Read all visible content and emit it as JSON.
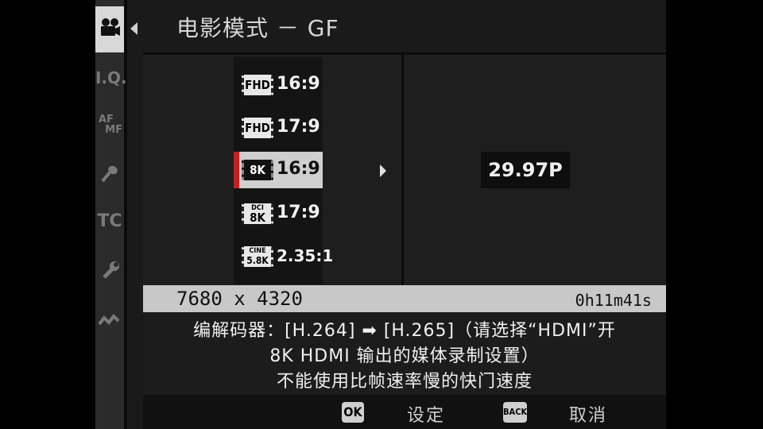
{
  "header": {
    "title": "电影模式 － GF"
  },
  "rail": {
    "icons": [
      {
        "name": "movie-camera-icon",
        "glyph": "🎥"
      },
      {
        "name": "image-quality-icon",
        "glyph": "I.Q."
      },
      {
        "name": "af-mf-icon",
        "glyph": "AF\nMF"
      },
      {
        "name": "microphone-icon",
        "glyph": "🎤"
      },
      {
        "name": "timecode-icon",
        "glyph": "TC"
      },
      {
        "name": "wrench-icon",
        "glyph": "🔧"
      },
      {
        "name": "connection-icon",
        "glyph": "⟿"
      }
    ]
  },
  "list": {
    "items": [
      {
        "badge_top": "",
        "badge": "FHD",
        "ratio": "16:9",
        "selected": false
      },
      {
        "badge_top": "",
        "badge": "FHD",
        "ratio": "17:9",
        "selected": false
      },
      {
        "badge_top": "",
        "badge": "8K",
        "ratio": "16:9",
        "selected": true
      },
      {
        "badge_top": "DCI",
        "badge": "8K",
        "ratio": "17:9",
        "selected": false
      },
      {
        "badge_top": "CINE",
        "badge": "5.8K",
        "ratio": "2.35:1",
        "selected": false
      }
    ]
  },
  "detail": {
    "frame_rate": "29.97P"
  },
  "status": {
    "resolution": "7680 x 4320",
    "time_remaining": "0h11m41s"
  },
  "message": {
    "line1": "编解码器：[H.264] ➡ [H.265]（请选择“HDMI”开",
    "line2": "8K HDMI 输出的媒体录制设置）",
    "line3": "不能使用比帧速率慢的快门速度"
  },
  "footer": {
    "ok_key": "OK",
    "ok_label": "设定",
    "back_key": "BACK",
    "back_label": "取消"
  },
  "colors": {
    "accent": "#c81e1e",
    "selected_bg": "#cfcfcf",
    "strip_bg": "#c8c8c8"
  }
}
